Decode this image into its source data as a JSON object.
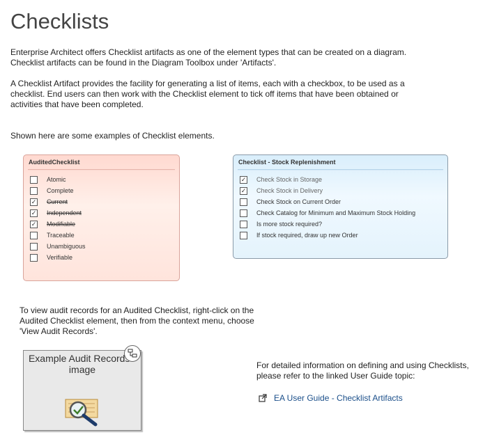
{
  "page": {
    "title": "Checklists",
    "intro_p1": "Enterprise Architect offers Checklist artifacts as one of the element types that can be created on a diagram.  Checklist artifacts can be found in the Diagram Toolbox under 'Artifacts'.",
    "intro_p2": "A Checklist Artifact provides the facility for generating a list of items, each with a checkbox, to be used as a checklist.  End users can then work with the Checklist element to tick off items that have been obtained or activities that have been completed.",
    "examples_intro": "Shown here are some examples of Checklist elements.",
    "audit_instructions": "To view audit records for an Audited Checklist, right-click on the Audited Checklist element, then from the context menu, choose 'View Audit Records'.",
    "more_info": "For detailed information on defining and using Checklists, please refer to the linked User Guide topic:",
    "link_label": "EA User Guide - Checklist Artifacts"
  },
  "audited_checklist": {
    "title": "AuditedChecklist",
    "items": [
      {
        "label": "Atomic",
        "checked": false
      },
      {
        "label": "Complete",
        "checked": false
      },
      {
        "label": "Current",
        "checked": true
      },
      {
        "label": "Independent",
        "checked": true
      },
      {
        "label": "Modifiable",
        "checked": true
      },
      {
        "label": "Traceable",
        "checked": false
      },
      {
        "label": "Unambiguous",
        "checked": false
      },
      {
        "label": "Verifiable",
        "checked": false
      }
    ]
  },
  "stock_checklist": {
    "title": "Checklist - Stock Replenishment",
    "items": [
      {
        "label": "Check Stock in Storage",
        "checked": true
      },
      {
        "label": "Check Stock in Delivery",
        "checked": true
      },
      {
        "label": "Check Stock on Current Order",
        "checked": false
      },
      {
        "label": "Check Catalog for Minimum and Maximum Stock Holding",
        "checked": false
      },
      {
        "label": "Is more stock required?",
        "checked": false
      },
      {
        "label": "If stock required, draw up new Order",
        "checked": false
      }
    ]
  },
  "audit_image": {
    "caption": "Example Audit Records - image",
    "icon": "magnifier-check-icon",
    "badge_icon": "hierarchy-icon"
  },
  "colors": {
    "link": "#1b4f8a",
    "audit_fill": "#fff0ea",
    "stock_fill": "#f0f9ff"
  }
}
